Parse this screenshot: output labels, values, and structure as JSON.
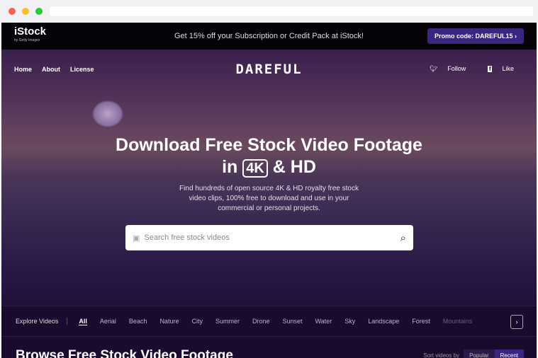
{
  "promo": {
    "logo": "iStock",
    "logo_sub": "by Getty Images",
    "text": "Get 15% off your Subscription or Credit Pack at iStock!",
    "button": "Promo code: DAREFUL15 ›"
  },
  "nav": {
    "items": [
      "Home",
      "About",
      "License"
    ],
    "brand": "DAREFUL",
    "follow": "Follow",
    "like": "Like"
  },
  "hero": {
    "title_line1": "Download Free Stock Video Footage",
    "title_in": "in",
    "title_4k": "4K",
    "title_hd": "& HD",
    "description": "Find hundreds of open source 4K & HD royalty free stock video clips, 100% free to download and use in your commercial or personal projects.",
    "search_placeholder": "Search free stock videos"
  },
  "explore": {
    "label": "Explore Videos",
    "categories": [
      "All",
      "Aerial",
      "Beach",
      "Nature",
      "City",
      "Summer",
      "Drone",
      "Sunset",
      "Water",
      "Sky",
      "Landscape",
      "Forest",
      "Mountains"
    ],
    "active": "All"
  },
  "browse": {
    "title": "Browse Free Stock Video Footage",
    "sort_label": "Sort videos by",
    "sort_options": [
      "Popular",
      "Recent"
    ],
    "sort_active": "Recent"
  }
}
